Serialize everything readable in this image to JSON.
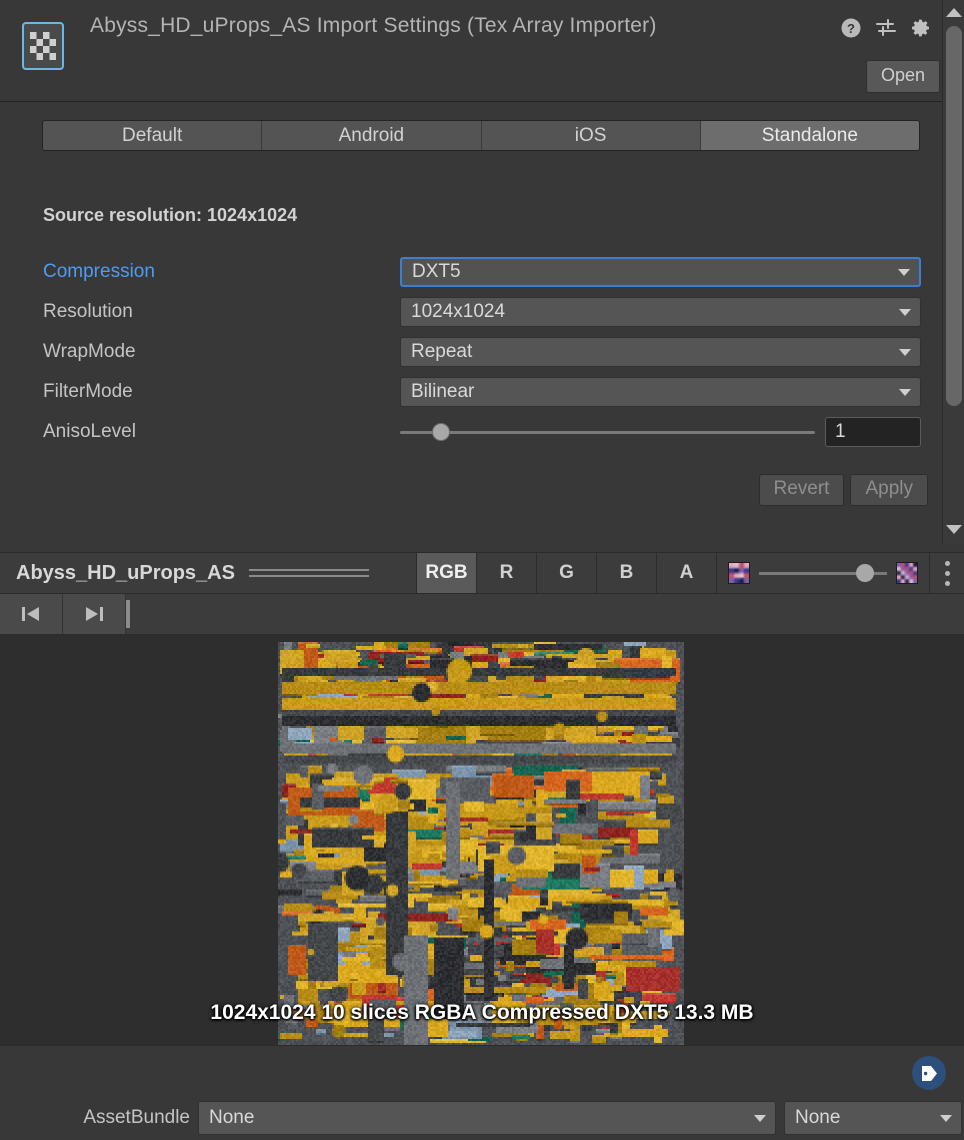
{
  "header": {
    "title": "Abyss_HD_uProps_AS Import Settings (Tex Array Importer)",
    "asset_icon": "texture-checker-icon",
    "icons": [
      {
        "name": "help-icon",
        "label": "?"
      },
      {
        "name": "preset-icon",
        "label": "presets"
      },
      {
        "name": "gear-icon",
        "label": "settings"
      }
    ],
    "open_label": "Open"
  },
  "tabs": [
    {
      "label": "Default",
      "active": false
    },
    {
      "label": "Android",
      "active": false
    },
    {
      "label": "iOS",
      "active": false
    },
    {
      "label": "Standalone",
      "active": true
    }
  ],
  "settings": {
    "source_resolution": "Source resolution: 1024x1024",
    "fields": [
      {
        "label": "Compression",
        "value": "DXT5",
        "type": "dropdown",
        "modified": true,
        "focused": true
      },
      {
        "label": "Resolution",
        "value": "1024x1024",
        "type": "dropdown",
        "modified": false,
        "focused": false
      },
      {
        "label": "WrapMode",
        "value": "Repeat",
        "type": "dropdown",
        "modified": false,
        "focused": false
      },
      {
        "label": "FilterMode",
        "value": "Bilinear",
        "type": "dropdown",
        "modified": false,
        "focused": false
      }
    ],
    "aniso": {
      "label": "AnisoLevel",
      "value": "1",
      "slider_percent": 8
    },
    "revert_label": "Revert",
    "apply_label": "Apply"
  },
  "preview": {
    "name": "Abyss_HD_uProps_AS",
    "channels": [
      {
        "label": "RGB",
        "active": true
      },
      {
        "label": "R",
        "active": false
      },
      {
        "label": "G",
        "active": false
      },
      {
        "label": "B",
        "active": false
      },
      {
        "label": "A",
        "active": false
      }
    ],
    "mip_slider_percent": 88,
    "nav_prev_icon": "skip-previous-icon",
    "nav_next_icon": "skip-next-icon",
    "kebab_icon": "more-options-icon",
    "info": "1024x1024 10 slices RGBA Compressed DXT5 13.3 MB"
  },
  "footer": {
    "tag_icon": "label-tag-icon",
    "assetbundle_label": "AssetBundle",
    "assetbundle_value": "None",
    "variant_value": "None"
  },
  "colors": {
    "background": "#383838",
    "accent_blue": "#4e9cf0",
    "focus_blue": "#3b7fd4",
    "field_bg": "#555555",
    "tab_active": "#6d6d6d"
  }
}
